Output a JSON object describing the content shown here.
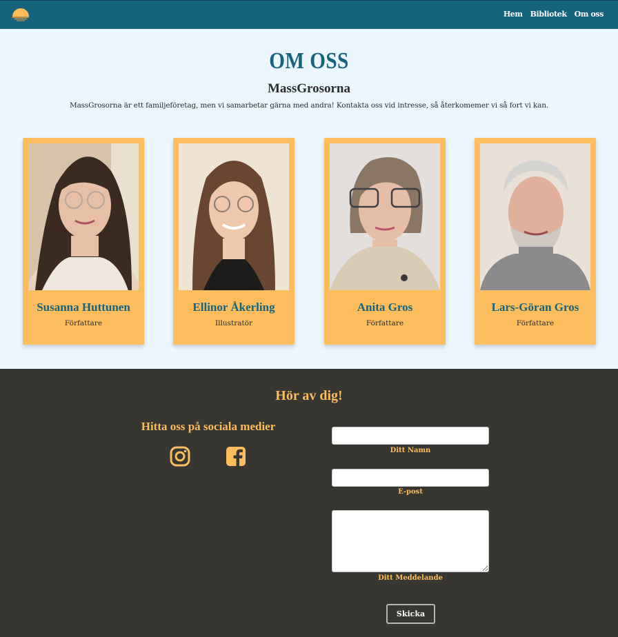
{
  "nav": {
    "logo_icon": "sunset-logo-icon",
    "links": [
      "Hem",
      "Bibliotek",
      "Om oss"
    ]
  },
  "main": {
    "title": "OM OSS",
    "subtitle": "MassGrosorna",
    "description": "MassGrosorna är ett familjeföretag, men vi samarbetar gärna med andra! Kontakta oss vid intresse, så återkomemer vi så fort vi kan.",
    "members": [
      {
        "name": "Susanna Huttunen",
        "role": "Författare"
      },
      {
        "name": "Ellinor Åkerling",
        "role": "Illustratör"
      },
      {
        "name": "Anita Gros",
        "role": "Författare"
      },
      {
        "name": "Lars-Göran Gros",
        "role": "Författare"
      }
    ]
  },
  "footer": {
    "title": "Hör av dig!",
    "social_heading": "Hitta oss på sociala medier",
    "social_icons": [
      "instagram-icon",
      "facebook-icon"
    ],
    "form": {
      "name_label": "Ditt Namn",
      "email_label": "E-post",
      "message_label": "Ditt Meddelande",
      "name_value": "",
      "email_value": "",
      "message_value": "",
      "submit_label": "Skicka"
    }
  },
  "colors": {
    "navbar": "#15637d",
    "accent": "#fdbd5d",
    "page_bg": "#ebf7fd",
    "footer_bg": "#373631"
  }
}
